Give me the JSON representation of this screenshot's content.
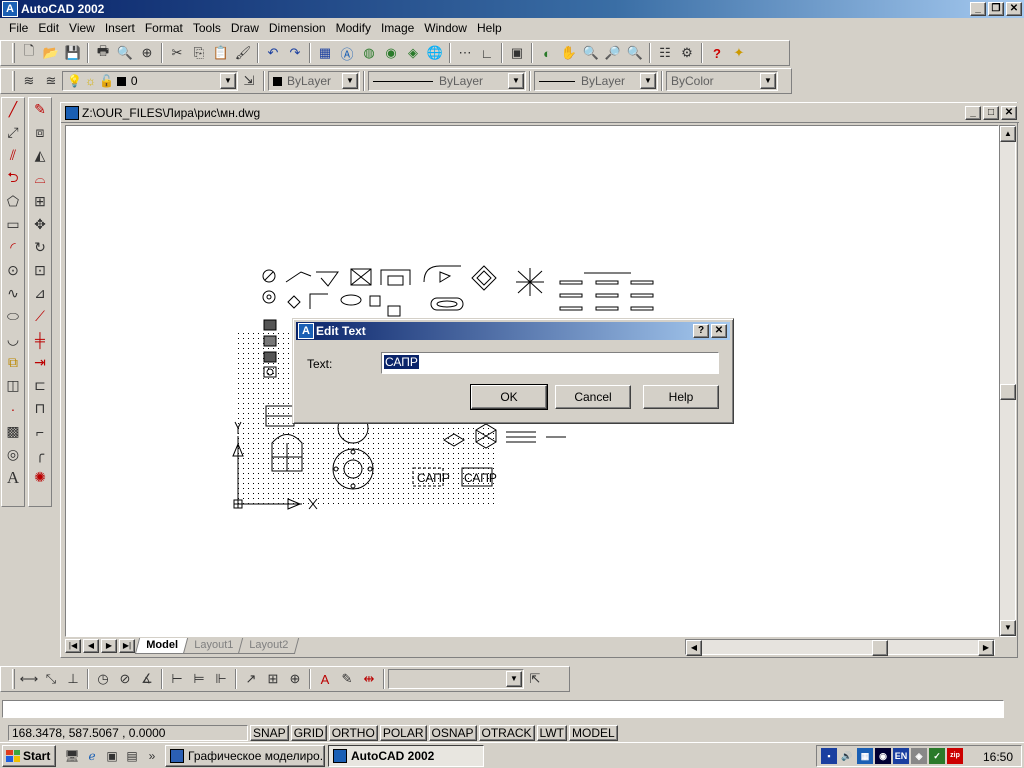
{
  "window": {
    "title": "AutoCAD 2002"
  },
  "menu": [
    "File",
    "Edit",
    "View",
    "Insert",
    "Format",
    "Tools",
    "Draw",
    "Dimension",
    "Modify",
    "Image",
    "Window",
    "Help"
  ],
  "properties": {
    "layer": "0",
    "color": "ByLayer",
    "linetype": "ByLayer",
    "lineweight": "ByLayer",
    "plotstyle": "ByColor"
  },
  "drawing": {
    "title": "Z:\\OUR_FILES\\Лира\\рис\\мн.dwg",
    "tabs": [
      {
        "label": "Model",
        "active": true
      },
      {
        "label": "Layout1",
        "active": false
      },
      {
        "label": "Layout2",
        "active": false
      }
    ],
    "sample_text": "САПР"
  },
  "dialog": {
    "title": "Edit Text",
    "help_glyph": "?",
    "label": "Text:",
    "value": "САПР",
    "ok": "OK",
    "cancel": "Cancel",
    "help": "Help"
  },
  "status": {
    "coords": "168.3478, 587.5067 , 0.0000",
    "buttons": [
      "SNAP",
      "GRID",
      "ORTHO",
      "POLAR",
      "OSNAP",
      "OTRACK",
      "LWT",
      "MODEL"
    ]
  },
  "taskbar": {
    "start": "Start",
    "tasks": [
      {
        "label": "Графическое моделиро...",
        "active": false
      },
      {
        "label": "AutoCAD 2002",
        "active": true
      }
    ],
    "tray_lang": "EN",
    "clock": "16:50"
  },
  "colors": {
    "title_active": "#0a246a",
    "selection": "#0a246a",
    "face": "#d4d0c8"
  }
}
